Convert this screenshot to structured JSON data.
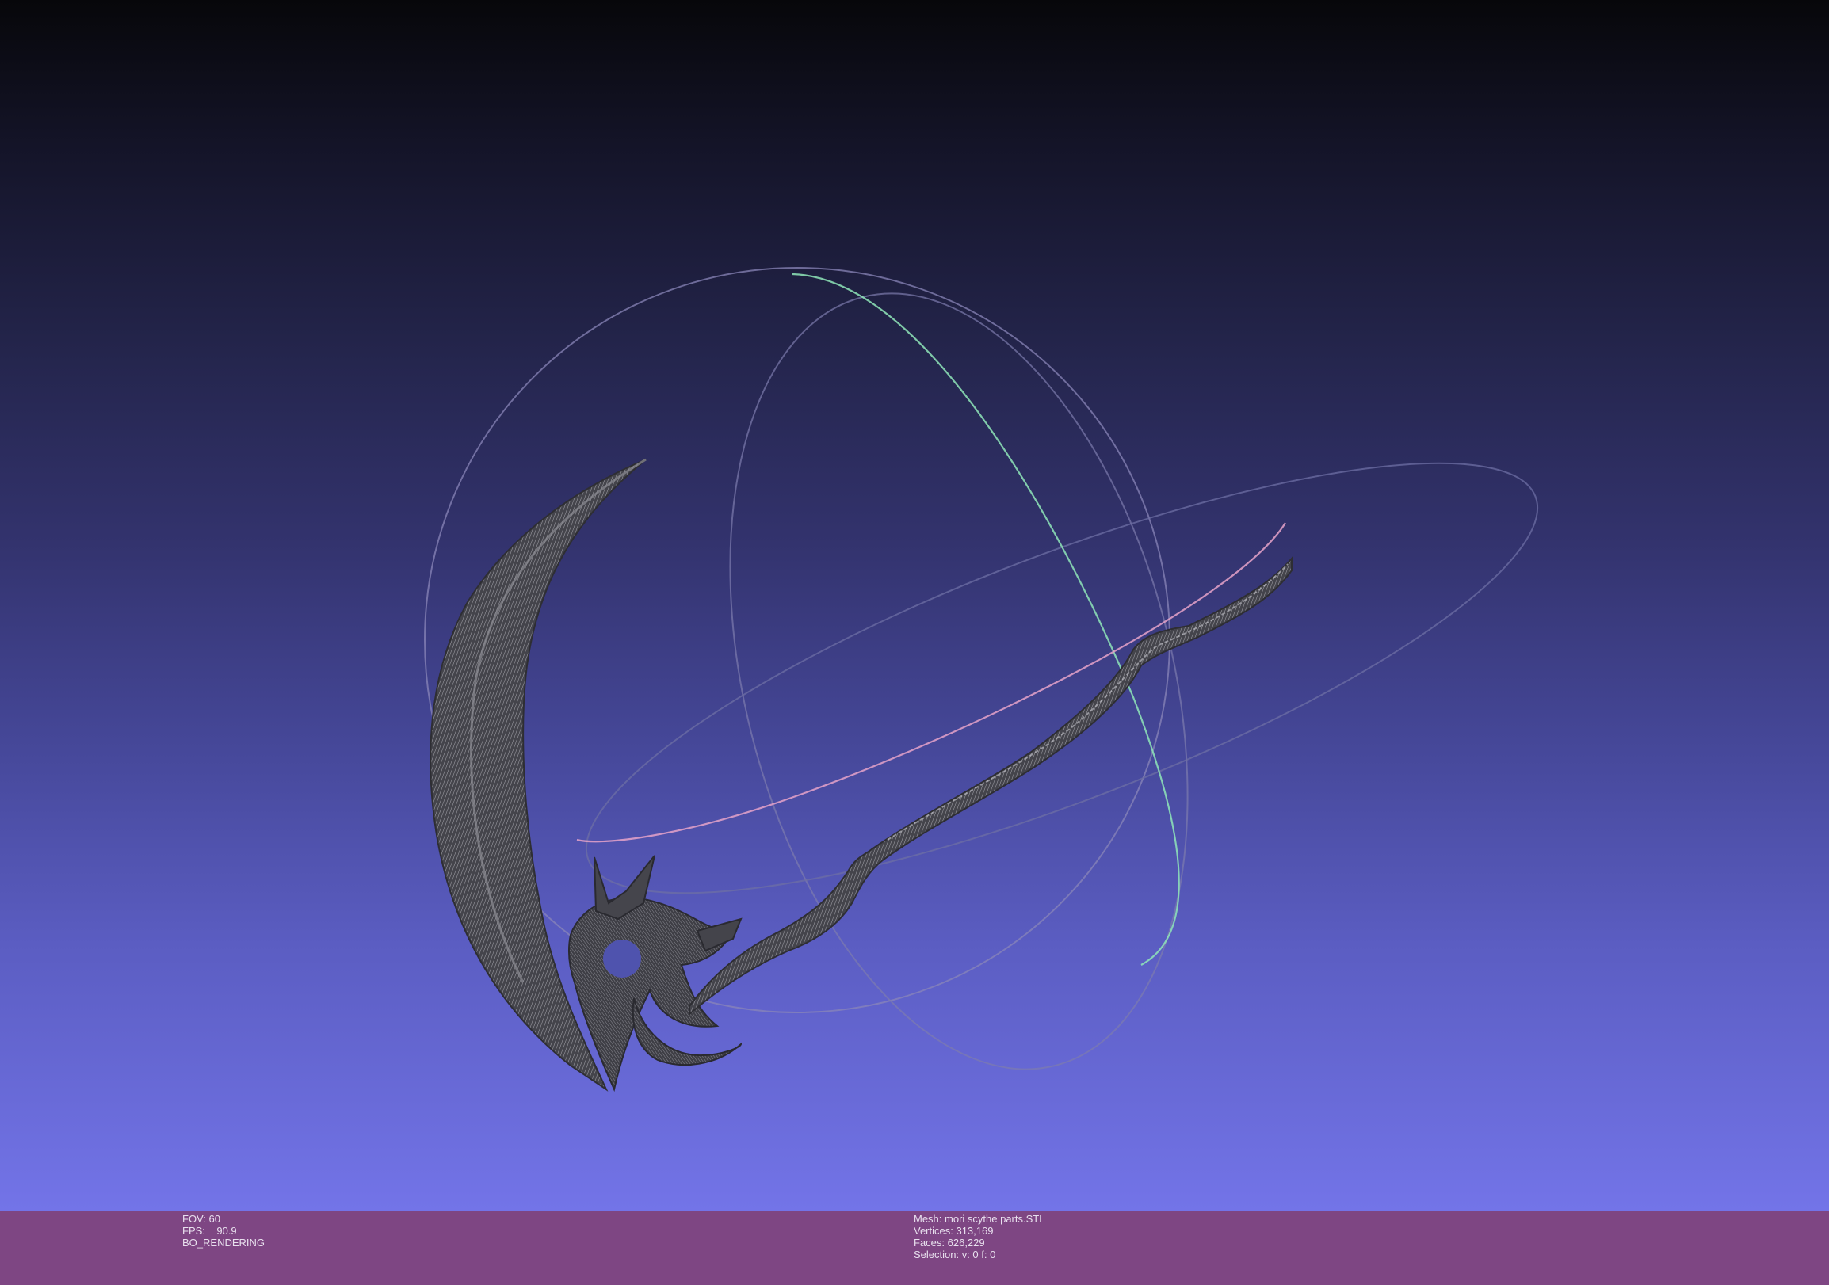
{
  "viewer": {
    "background_gradient": [
      "#07070a",
      "#7374e8"
    ],
    "status_bar_color": "#7e4683"
  },
  "status_left": {
    "fov_label": "FOV:",
    "fov_value": "60",
    "fps_label": "FPS:",
    "fps_value": "90.9",
    "render_mode": "BO_RENDERING"
  },
  "status_right": {
    "mesh": "Mesh: mori scythe parts.STL",
    "vertices": "Vertices: 313,169",
    "faces": "Faces: 626,229",
    "selection": "Selection: v: 0 f: 0"
  },
  "trackball": {
    "colors": {
      "outer": "#8a86b8",
      "vertical": "#7e7cae",
      "horizontal": "#6e6fa4",
      "green_arc": "#8fe6b8",
      "pink_arc": "#e6a3c9"
    }
  },
  "mesh_object": {
    "name": "scythe-mesh",
    "color": "#4a4a50"
  }
}
